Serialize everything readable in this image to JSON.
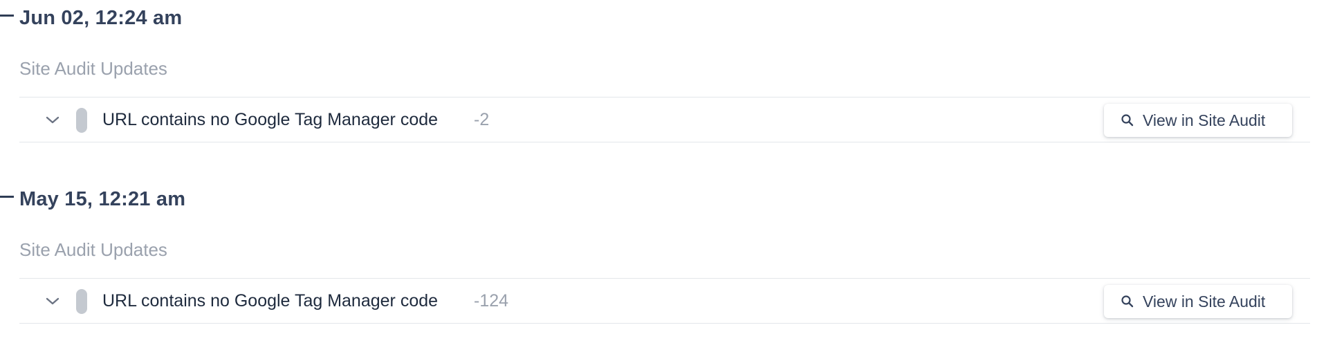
{
  "timeline": {
    "entries": [
      {
        "date": "Jun 02, 12:24 am",
        "section_label": "Site Audit Updates",
        "issue": {
          "title": "URL contains no Google Tag Manager code",
          "delta": "-2",
          "button_label": "View in Site Audit"
        }
      },
      {
        "date": "May 15, 12:21 am",
        "section_label": "Site Audit Updates",
        "issue": {
          "title": "URL contains no Google Tag Manager code",
          "delta": "-124",
          "button_label": "View in Site Audit"
        }
      }
    ]
  },
  "colors": {
    "date_text": "#34425c",
    "muted_text": "#9aa1ad",
    "status_pill": "#c4c9d0",
    "divider": "#e3e6ea"
  },
  "icons": {
    "expand": "chevron-down-icon",
    "search": "search-icon"
  }
}
